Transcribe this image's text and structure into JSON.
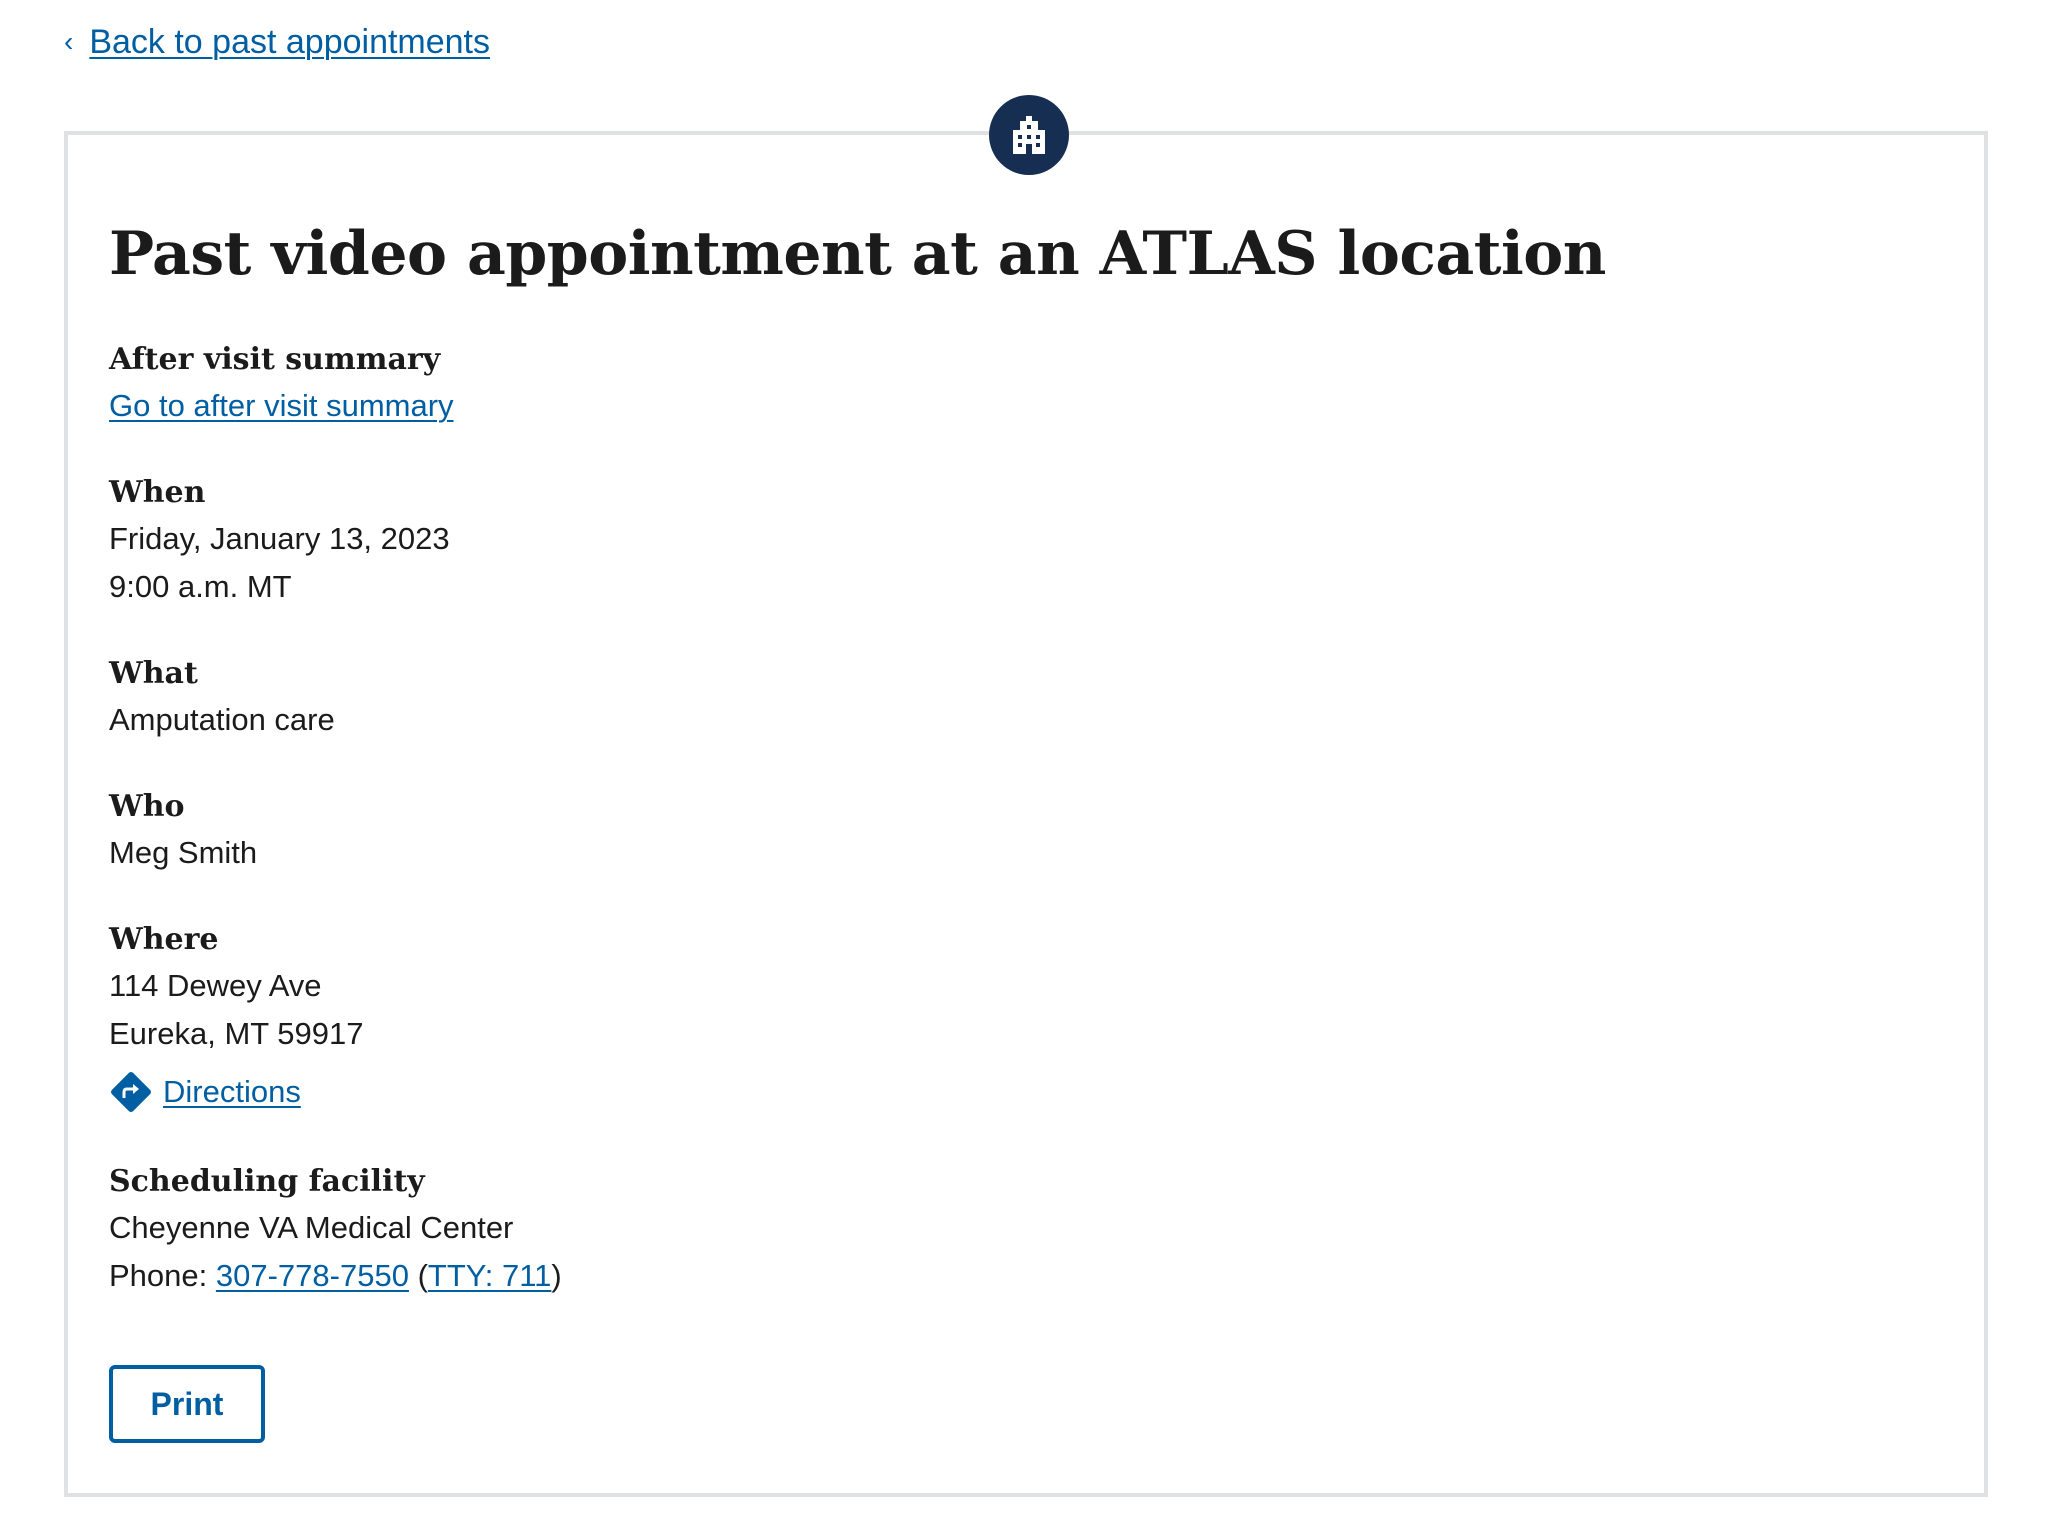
{
  "back_link": {
    "label": "Back to past appointments"
  },
  "badge": {
    "icon": "building-icon"
  },
  "title": "Past video appointment at an ATLAS location",
  "after_visit": {
    "heading": "After visit summary",
    "link": "Go to after visit summary"
  },
  "when": {
    "heading": "When",
    "date": "Friday, January 13, 2023",
    "time": "9:00 a.m. MT"
  },
  "what": {
    "heading": "What",
    "value": "Amputation care"
  },
  "who": {
    "heading": "Who",
    "value": "Meg Smith"
  },
  "where": {
    "heading": "Where",
    "line1": "114 Dewey Ave",
    "line2": "Eureka, MT 59917",
    "directions": "Directions"
  },
  "facility": {
    "heading": "Scheduling facility",
    "name": "Cheyenne VA Medical Center",
    "phone_prefix": "Phone: ",
    "phone": "307-778-7550",
    "open_paren": "(",
    "tty": "TTY: 711",
    "close_paren": ")"
  },
  "print_label": "Print",
  "colors": {
    "link": "#005ea2",
    "badge": "#162e51",
    "border": "#dfe1e2"
  }
}
